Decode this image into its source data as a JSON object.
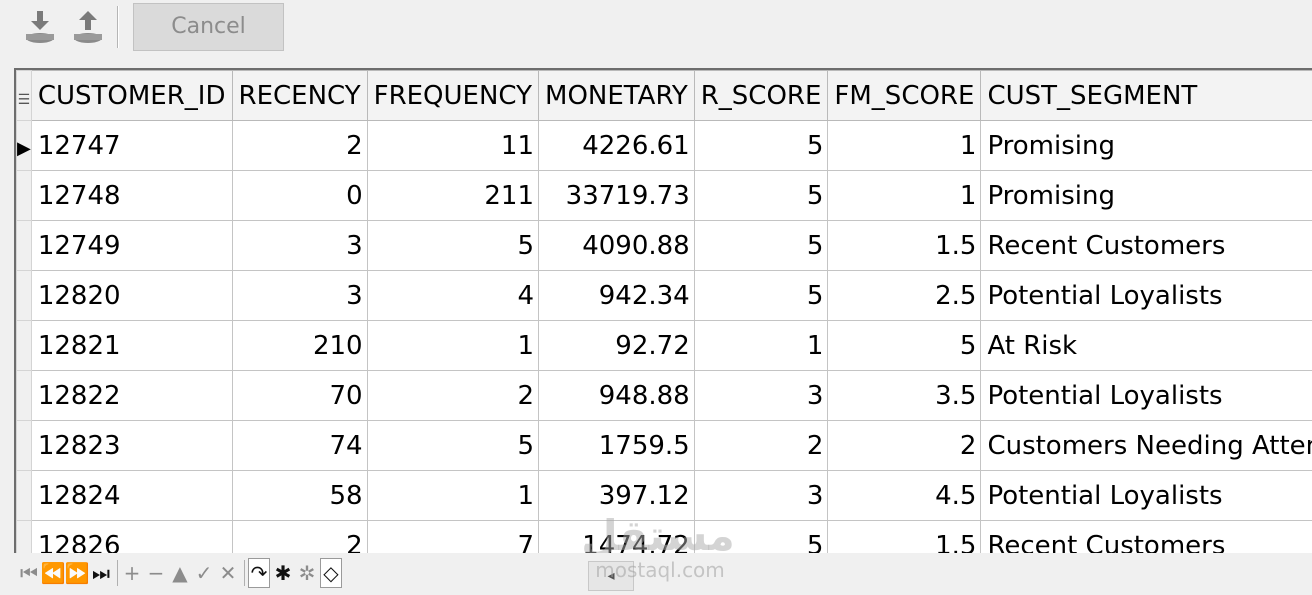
{
  "toolbar": {
    "cancel_label": "Cancel",
    "icons": [
      "download-icon",
      "upload-icon"
    ]
  },
  "grid": {
    "columns": [
      "CUSTOMER_ID",
      "RECENCY",
      "FREQUENCY",
      "MONETARY",
      "R_SCORE",
      "FM_SCORE",
      "CUST_SEGMENT"
    ],
    "rows": [
      [
        "12747",
        "2",
        "11",
        "4226.61",
        "5",
        "1",
        "Promising"
      ],
      [
        "12748",
        "0",
        "211",
        "33719.73",
        "5",
        "1",
        "Promising"
      ],
      [
        "12749",
        "3",
        "5",
        "4090.88",
        "5",
        "1.5",
        "Recent Customers"
      ],
      [
        "12820",
        "3",
        "4",
        "942.34",
        "5",
        "2.5",
        "Potential Loyalists"
      ],
      [
        "12821",
        "210",
        "1",
        "92.72",
        "1",
        "5",
        "At Risk"
      ],
      [
        "12822",
        "70",
        "2",
        "948.88",
        "3",
        "3.5",
        "Potential Loyalists"
      ],
      [
        "12823",
        "74",
        "5",
        "1759.5",
        "2",
        "2",
        "Customers Needing Attention"
      ],
      [
        "12824",
        "58",
        "1",
        "397.12",
        "3",
        "4.5",
        "Potential Loyalists"
      ],
      [
        "12826",
        "2",
        "7",
        "1474.72",
        "5",
        "1.5",
        "Recent Customers"
      ]
    ],
    "current_row_indicator": "▶",
    "header_indicator": "☰"
  },
  "navigator": {
    "buttons": [
      {
        "name": "first-record-icon",
        "glyph": "⏮",
        "active": false
      },
      {
        "name": "prior-page-icon",
        "glyph": "⏪",
        "active": false
      },
      {
        "name": "next-page-icon",
        "glyph": "⏩",
        "active": true
      },
      {
        "name": "last-record-icon",
        "glyph": "⏭",
        "active": true
      },
      {
        "name": "insert-icon",
        "glyph": "+",
        "active": false
      },
      {
        "name": "delete-icon",
        "glyph": "−",
        "active": false
      },
      {
        "name": "edit-icon",
        "glyph": "▲",
        "active": false
      },
      {
        "name": "post-icon",
        "glyph": "✓",
        "active": false
      },
      {
        "name": "cancel-edit-icon",
        "glyph": "✕",
        "active": false
      },
      {
        "name": "refresh-icon",
        "glyph": "↷",
        "active": true
      },
      {
        "name": "apply-updates-icon",
        "glyph": "✱",
        "active": true
      },
      {
        "name": "cancel-updates-icon",
        "glyph": "✲",
        "active": false
      },
      {
        "name": "clear-filter-icon",
        "glyph": "◇",
        "active": true
      }
    ],
    "scroll_left_glyph": "◂"
  },
  "watermark": {
    "text": "مستقل",
    "sub": "mostaql.com"
  }
}
